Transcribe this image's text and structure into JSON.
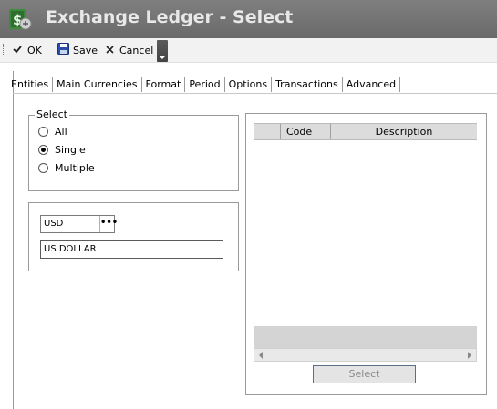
{
  "window": {
    "title": "Exchange Ledger - Select",
    "icon": "ledger-app-icon"
  },
  "toolbar": {
    "ok_label": "OK",
    "save_label": "Save",
    "cancel_label": "Cancel",
    "ok_icon": "checkmark-icon",
    "save_icon": "floppy-disk-icon",
    "cancel_icon": "x-icon"
  },
  "tabs": [
    {
      "label": "Entities"
    },
    {
      "label": "Main Currencies",
      "active": true
    },
    {
      "label": "Format"
    },
    {
      "label": "Period"
    },
    {
      "label": "Options"
    },
    {
      "label": "Transactions"
    },
    {
      "label": "Advanced"
    }
  ],
  "select_group": {
    "legend": "Select",
    "options": [
      {
        "label": "All",
        "checked": false
      },
      {
        "label": "Single",
        "checked": true
      },
      {
        "label": "Multiple",
        "checked": false
      }
    ]
  },
  "currency": {
    "code": "USD",
    "lookup_button": "•••",
    "description": "US DOLLAR"
  },
  "grid": {
    "columns": [
      "",
      "Code",
      "Description"
    ],
    "rows": []
  },
  "select_button": "Select",
  "colors": {
    "titlebar": "#6f6f6f",
    "title_text": "#e8e8e8",
    "toolbar_bg": "#f2f2f2",
    "grid_header": "#dcdcdc"
  }
}
